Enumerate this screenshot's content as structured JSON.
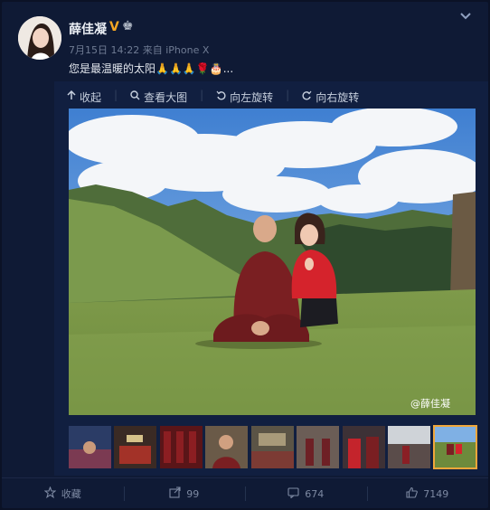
{
  "user": {
    "name": "薛佳凝",
    "verified_badge": "V",
    "crown_icon": "♚"
  },
  "post": {
    "date": "7月15日 14:22",
    "source_prefix": "来自",
    "source": "iPhone X",
    "text": "您是最温暖的太阳🙏🙏🙏🌹🎂..."
  },
  "toolbar": {
    "collapse": "收起",
    "view_large": "查看大图",
    "rotate_left": "向左旋转",
    "rotate_right": "向右旋转"
  },
  "image": {
    "watermark": "@薛佳凝"
  },
  "thumbnails": {
    "count": 9,
    "selected_index": 8
  },
  "footer": {
    "favorite": "收藏",
    "repost_count": "99",
    "comment_count": "674",
    "like_count": "7149"
  },
  "colors": {
    "page_bg": "#0b1226",
    "card_bg": "#0f1a35",
    "panel_bg": "#111f40",
    "verified": "#f5a623",
    "thumb_active": "#f0a63a"
  }
}
